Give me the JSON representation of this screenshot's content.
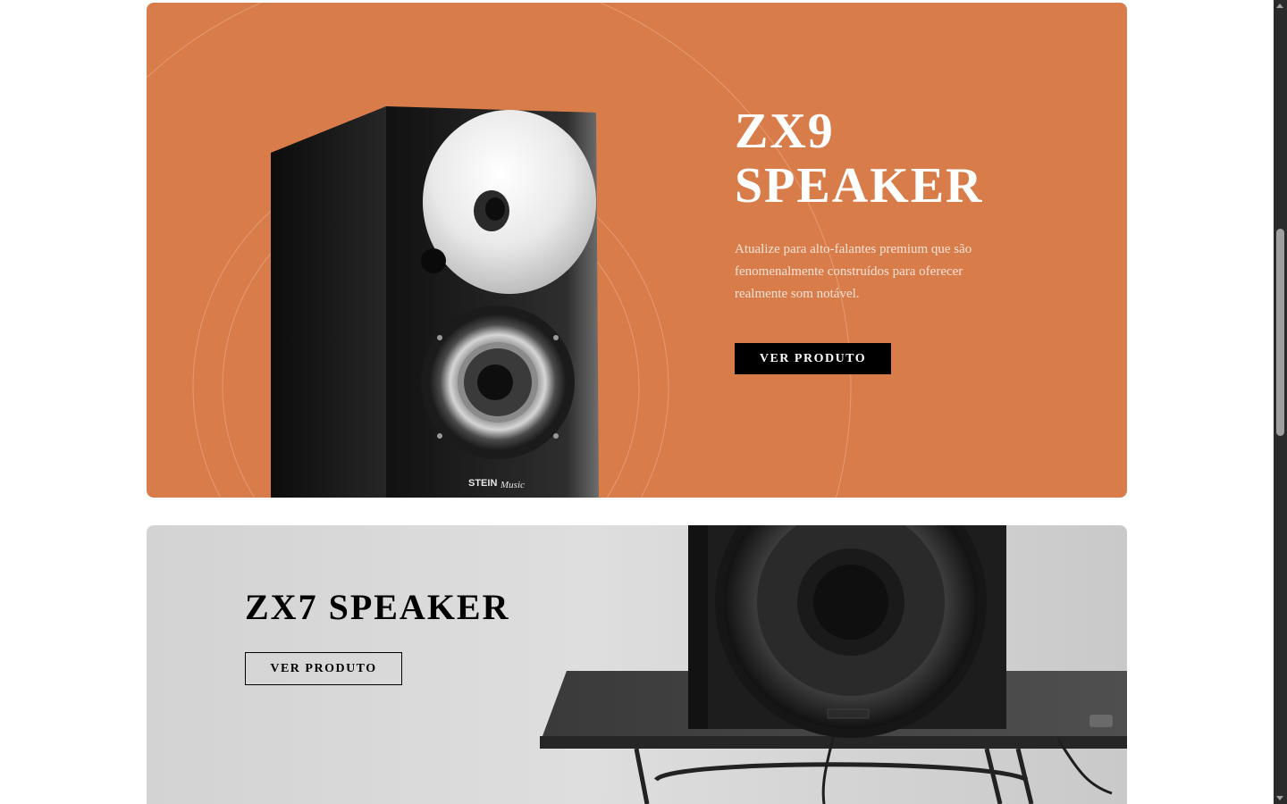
{
  "zx9": {
    "title_line1": "ZX9",
    "title_line2": "SPEAKER",
    "description": "Atualize para alto-falantes premium que são fenomenalmente construídos para oferecer realmente som notável.",
    "button_label": "VER PRODUTO",
    "speaker_brand": "STEIN",
    "speaker_brand_script": "Music",
    "accent_color": "#d87c4a",
    "button_color": "#000000"
  },
  "zx7": {
    "title": "ZX7 SPEAKER",
    "button_label": "VER PRODUTO",
    "background_color": "#d9d9d9"
  },
  "scrollbar": {
    "thumb_icon": "scroll-thumb"
  }
}
